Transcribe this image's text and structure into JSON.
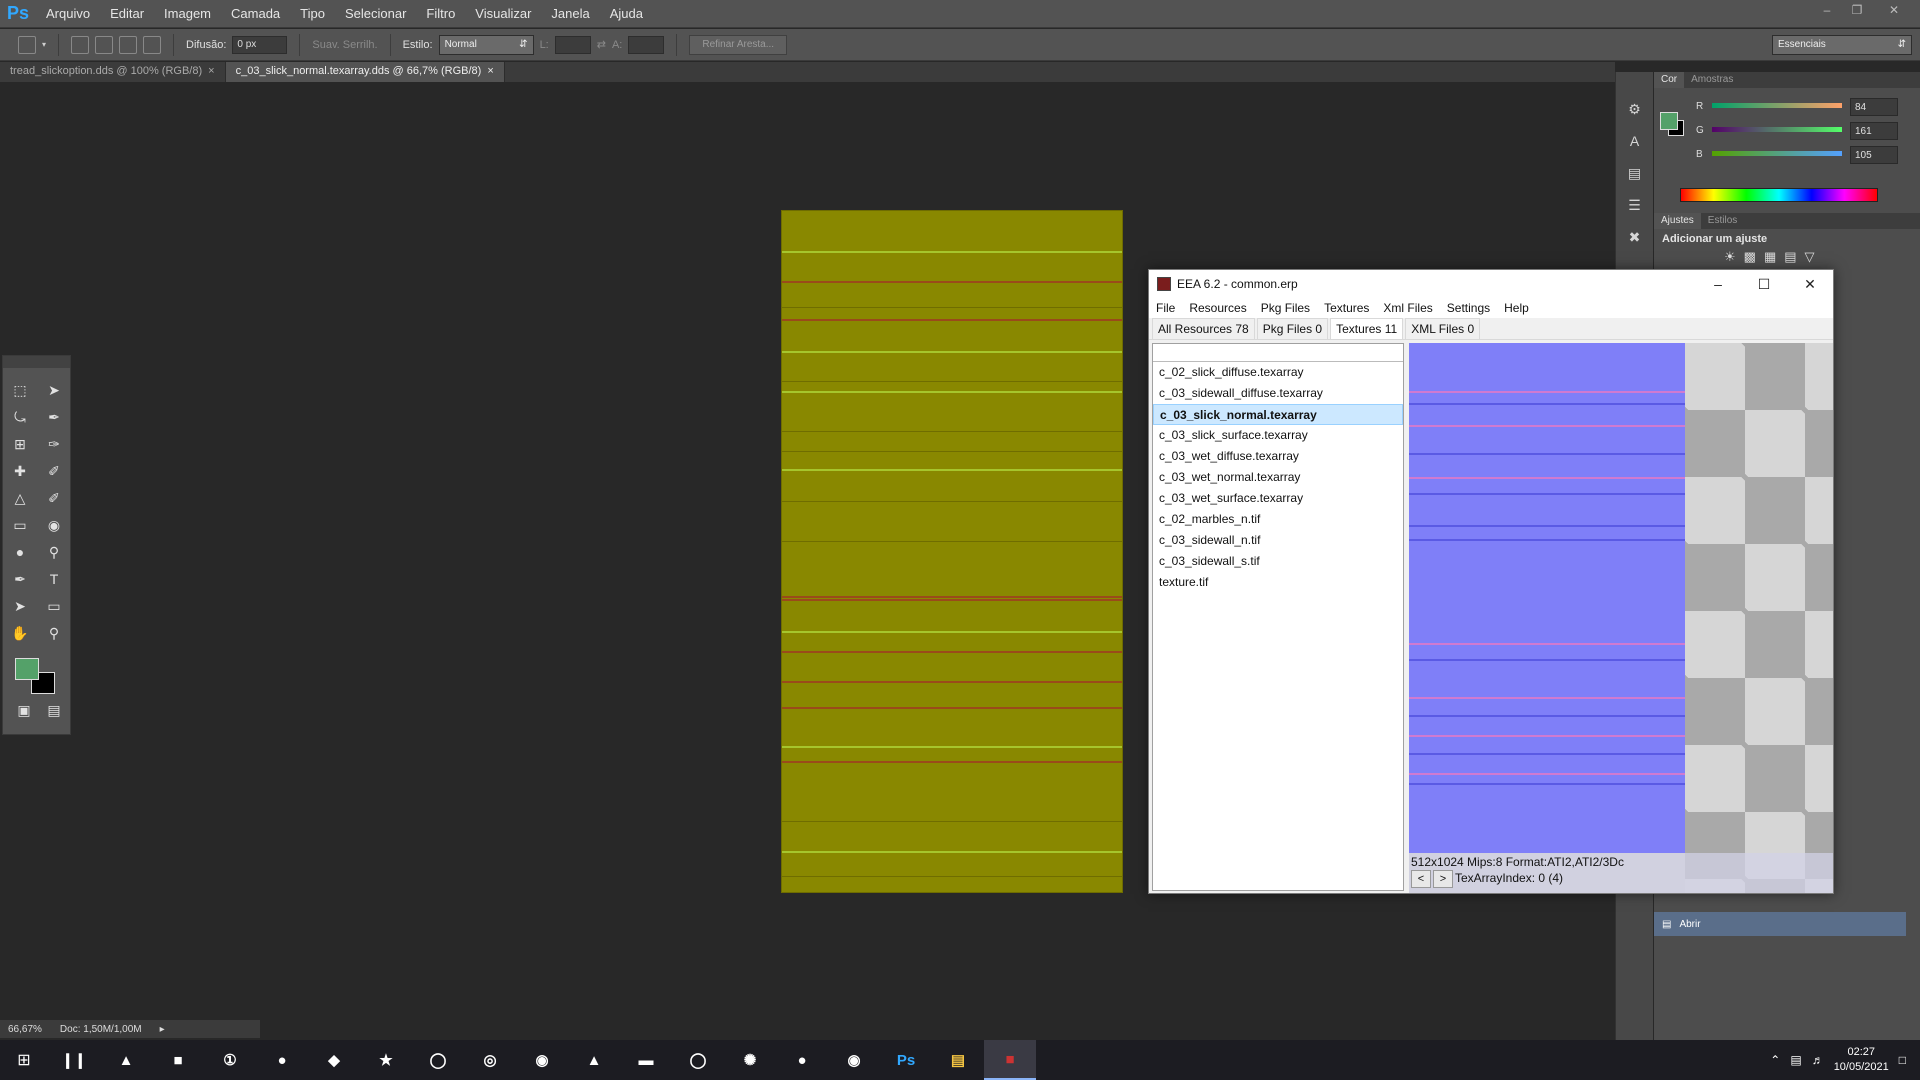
{
  "ps": {
    "menu": [
      "Arquivo",
      "Editar",
      "Imagem",
      "Camada",
      "Tipo",
      "Selecionar",
      "Filtro",
      "Visualizar",
      "Janela",
      "Ajuda"
    ],
    "options": {
      "feather_label": "Difusão:",
      "feather_value": "0 px",
      "antialias_label": "Suav. Serrilh.",
      "style_label": "Estilo:",
      "style_value": "Normal",
      "width_label": "L:",
      "height_label": "A:",
      "refine_label": "Refinar Aresta...",
      "workspace": "Essenciais"
    },
    "tabs": [
      {
        "label": "tread_slickoption.dds @ 100% (RGB/8)",
        "active": false
      },
      {
        "label": "c_03_slick_normal.texarray.dds @ 66,7% (RGB/8)",
        "active": true
      }
    ],
    "status": {
      "zoom": "66,67%",
      "doc": "Doc: 1,50M/1,00M"
    },
    "color_panel": {
      "tabs": [
        "Cor",
        "Amostras"
      ],
      "r_label": "R",
      "r_value": "84",
      "g_label": "G",
      "g_value": "161",
      "b_label": "B",
      "b_value": "105",
      "foreground": "#54a169"
    },
    "adjust_panel": {
      "tabs": [
        "Ajustes",
        "Estilos"
      ],
      "title": "Adicionar um ajuste"
    },
    "history": {
      "item": "Abrir"
    }
  },
  "eea": {
    "title": "EEA 6.2 - common.erp",
    "menu": [
      "File",
      "Resources",
      "Pkg Files",
      "Textures",
      "Xml Files",
      "Settings",
      "Help"
    ],
    "tabs": [
      "All Resources 78",
      "Pkg Files 0",
      "Textures 11",
      "XML Files 0"
    ],
    "files": [
      "c_02_slick_diffuse.texarray",
      "c_03_sidewall_diffuse.texarray",
      "c_03_slick_normal.texarray",
      "c_03_slick_surface.texarray",
      "c_03_wet_diffuse.texarray",
      "c_03_wet_normal.texarray",
      "c_03_wet_surface.texarray",
      "c_02_marbles_n.tif",
      "c_03_sidewall_n.tif",
      "c_03_sidewall_s.tif",
      "texture.tif"
    ],
    "info_line1": "512x1024 Mips:8 Format:ATI2,ATI2/3Dc",
    "info_line2": "TexArrayIndex: 0 (4)",
    "prev_label": "<",
    "next_label": ">"
  },
  "taskbar": {
    "time": "02:27",
    "date": "10/05/2021",
    "ps_label": "Ps",
    "icons": [
      "task-view",
      "drive",
      "game-1",
      "app-7",
      "game-5",
      "game-blue",
      "game-gold",
      "app-circle",
      "app-chart",
      "steam-s",
      "motogp-21",
      "game-flag",
      "app-u",
      "app-fan",
      "app-red",
      "firefox",
      "photoshop",
      "explorer",
      "eea"
    ]
  }
}
